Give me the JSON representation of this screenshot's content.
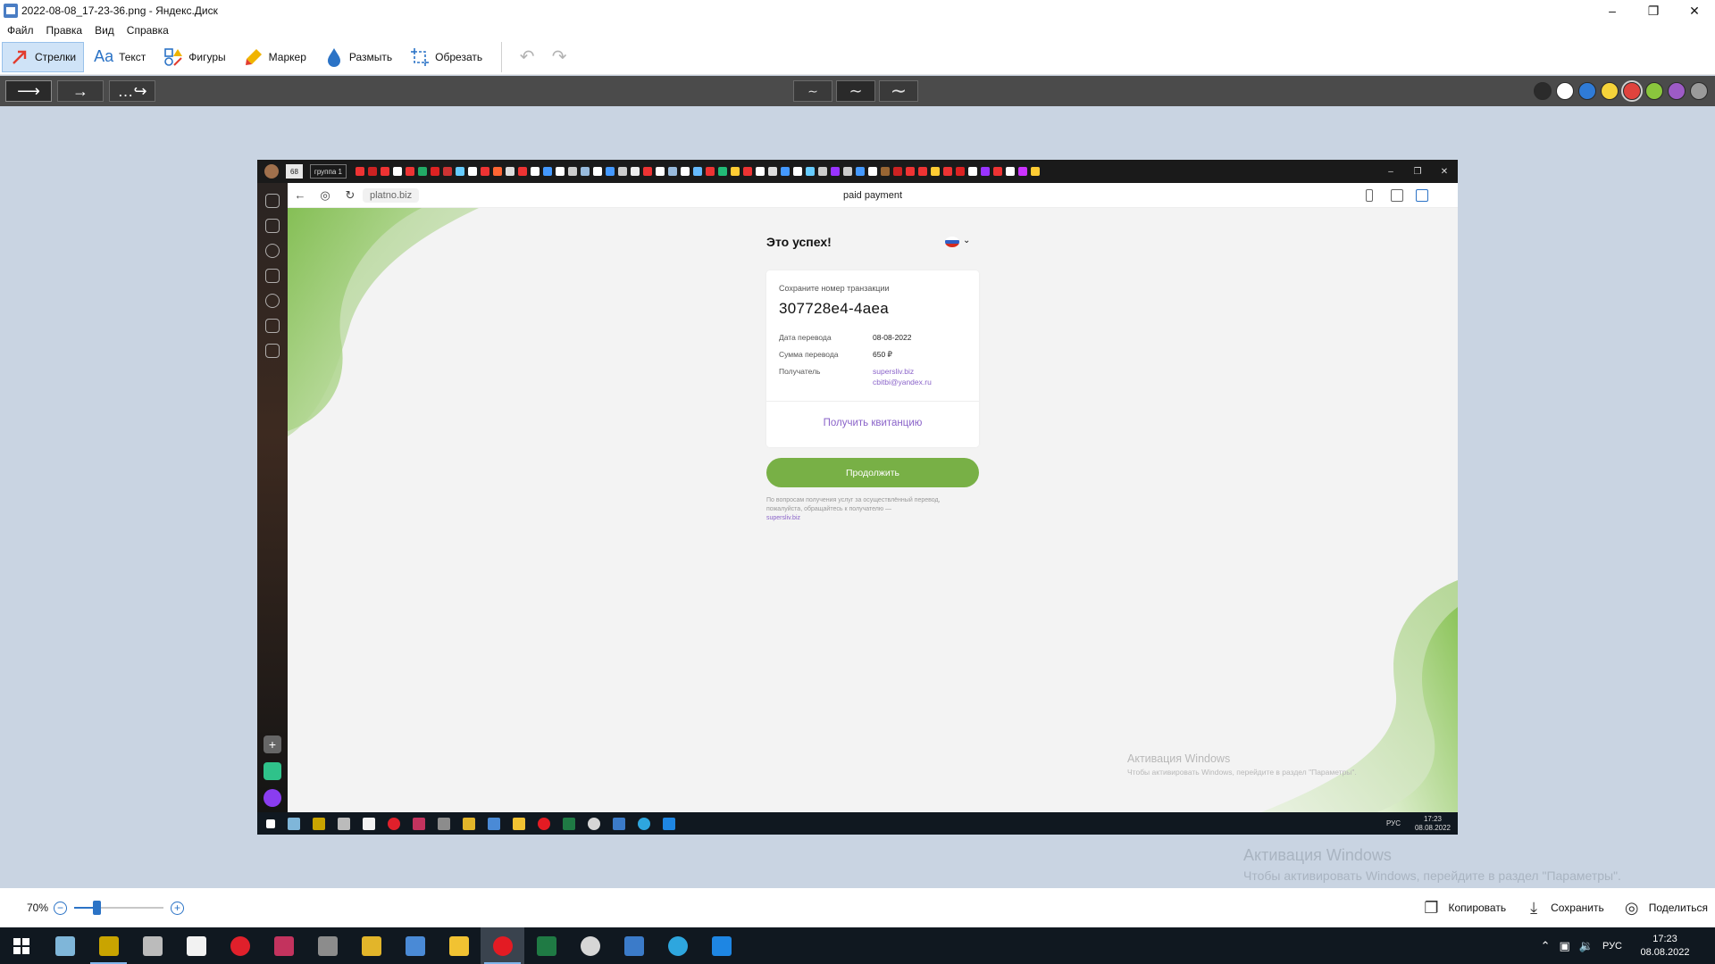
{
  "window": {
    "title": "2022-08-08_17-23-36.png - Яндекс.Диск",
    "controls": [
      "minimize",
      "restore",
      "close"
    ]
  },
  "menu": [
    "Файл",
    "Правка",
    "Вид",
    "Справка"
  ],
  "toolbar": {
    "tools": [
      {
        "label": "Стрелки",
        "icon": "arrow-icon",
        "active": true
      },
      {
        "label": "Текст",
        "icon": "text-icon"
      },
      {
        "label": "Фигуры",
        "icon": "shapes-icon"
      },
      {
        "label": "Маркер",
        "icon": "marker-icon"
      },
      {
        "label": "Размыть",
        "icon": "blur-icon"
      },
      {
        "label": "Обрезать",
        "icon": "crop-icon"
      }
    ],
    "undo_icon": "undo-icon",
    "redo_icon": "redo-icon"
  },
  "subbar": {
    "arrow_styles": [
      "straight-arrow",
      "thin-arrow",
      "dotted-arrow"
    ],
    "stroke_widths": [
      "thin",
      "medium",
      "thick"
    ],
    "colors": [
      "#2b2b2b",
      "#ffffff",
      "#2f7bd6",
      "#f5d33a",
      "#e0433d",
      "#8ac63d",
      "#9d5bc6",
      "#9a9a9a"
    ],
    "selected_color": "#e0433d"
  },
  "screenshot": {
    "browser": {
      "tab_group": "группа 1",
      "url": "platno.biz",
      "page_title": "paid payment"
    },
    "page": {
      "heading": "Это успех!",
      "card": {
        "caption": "Сохраните номер транзакции",
        "transaction_id": "307728e4-4aea",
        "date_label": "Дата перевода",
        "date_value": "08-08-2022",
        "amount_label": "Сумма перевода",
        "amount_value": "650 ₽",
        "recipient_label": "Получатель",
        "recipient_site": "supersliv.biz",
        "recipient_email": "cbitbi@yandex.ru",
        "receipt_link": "Получить квитанцию"
      },
      "continue_button": "Продолжить",
      "note_text": "По вопросам получения услуг за осуществлённый перевод, пожалуйста, обращайтесь к получателю —",
      "note_link": "supersliv.biz",
      "watermark_title": "Активация Windows",
      "watermark_text": "Чтобы активировать Windows, перейдите в раздел \"Параметры\"."
    },
    "taskbar": {
      "lang": "РУС",
      "time": "17:23",
      "date": "08.08.2022"
    }
  },
  "outer_watermark": {
    "title": "Активация Windows",
    "text": "Чтобы активировать Windows, перейдите в раздел \"Параметры\"."
  },
  "bottombar": {
    "zoom": "70%",
    "zoom_level": 0.25,
    "copy_label": "Копировать",
    "save_label": "Сохранить",
    "share_label": "Поделиться"
  },
  "taskbar": {
    "lang": "РУС",
    "time": "17:23",
    "date": "08.08.2022",
    "apps": [
      {
        "name": "notepad-app-icon",
        "color": "#7fb6d9"
      },
      {
        "name": "game-app-icon",
        "color": "#c9a400"
      },
      {
        "name": "video-editor-icon",
        "color": "#bbbbbb"
      },
      {
        "name": "document-icon",
        "color": "#f2f2f2"
      },
      {
        "name": "opera-icon",
        "color": "#e0202b"
      },
      {
        "name": "media-app-icon",
        "color": "#c3335e"
      },
      {
        "name": "tank-game-icon",
        "color": "#8c8c8c"
      },
      {
        "name": "binance-icon",
        "color": "#e2b52a"
      },
      {
        "name": "picture-app-icon",
        "color": "#4a8ad6"
      },
      {
        "name": "file-explorer-icon",
        "color": "#f1c232"
      },
      {
        "name": "yandex-browser-icon",
        "color": "#e31b23"
      },
      {
        "name": "excel-icon",
        "color": "#1f7a44"
      },
      {
        "name": "obs-icon",
        "color": "#d6d6d6"
      },
      {
        "name": "screenshot-app-icon",
        "color": "#3b7bc9"
      },
      {
        "name": "telegram-icon",
        "color": "#2ea6de"
      },
      {
        "name": "mail-icon",
        "color": "#1e86e3"
      }
    ]
  }
}
